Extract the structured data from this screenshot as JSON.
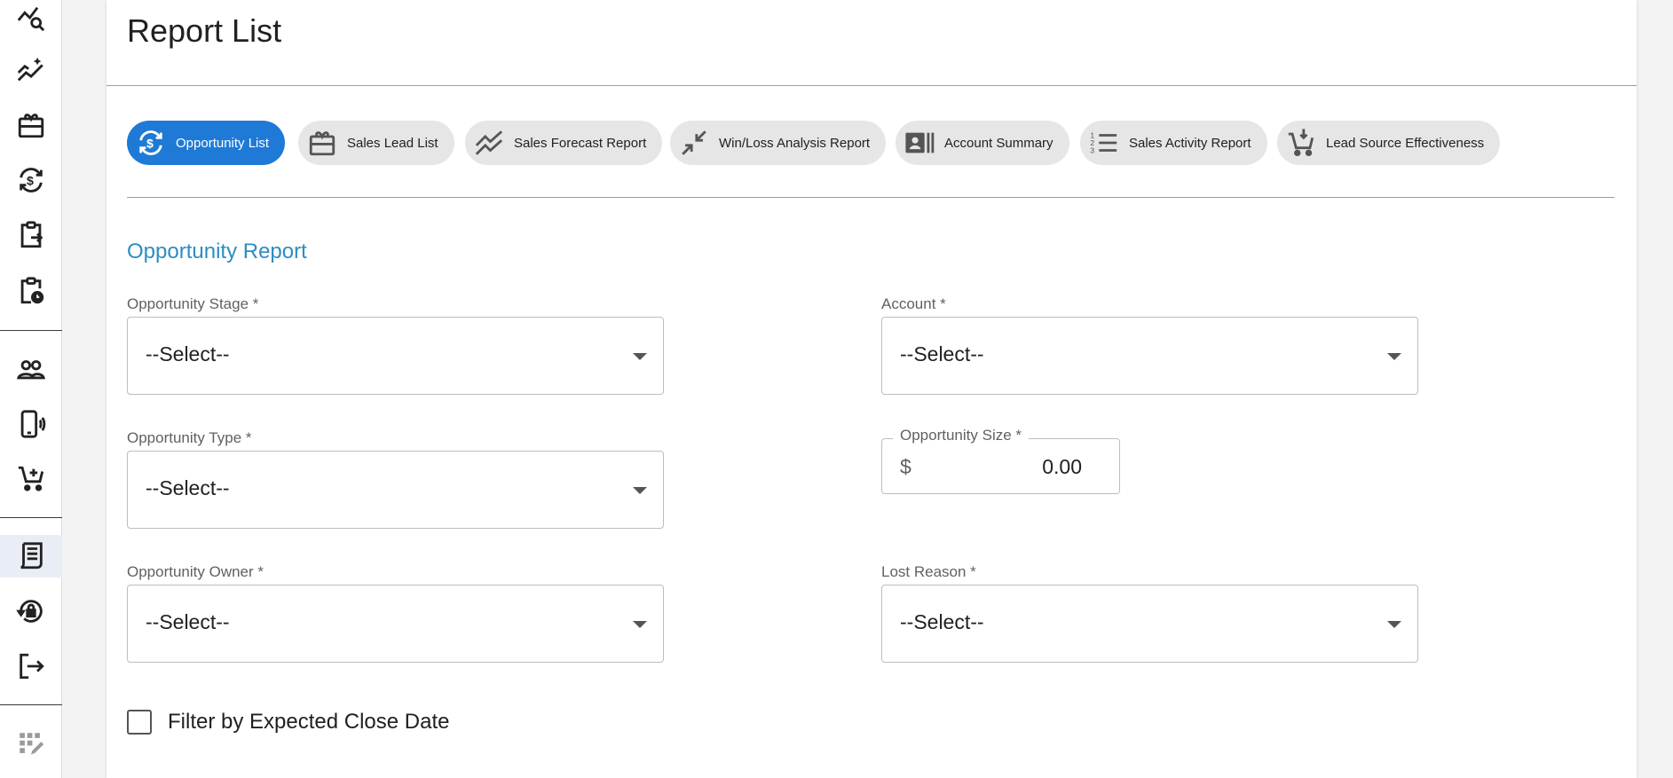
{
  "sidebar": {
    "items": [
      {
        "icon": "analytics-search-icon"
      },
      {
        "icon": "trend-sparkle-icon"
      },
      {
        "icon": "gift-card-icon"
      },
      {
        "icon": "currency-exchange-icon"
      },
      {
        "icon": "clipboard-move-icon"
      },
      {
        "icon": "clipboard-clock-icon"
      },
      {
        "icon": "people-icon"
      },
      {
        "icon": "phone-vibrate-icon"
      },
      {
        "icon": "add-cart-icon"
      },
      {
        "icon": "receipt-report-icon"
      },
      {
        "icon": "lock-reset-icon"
      },
      {
        "icon": "logout-icon"
      },
      {
        "icon": "grid-edit-icon"
      }
    ],
    "active_index": 9
  },
  "page": {
    "title": "Report List"
  },
  "tabs": [
    {
      "label": "Opportunity List",
      "icon": "currency-exchange-icon",
      "active": true
    },
    {
      "label": "Sales Lead List",
      "icon": "gift-card-icon",
      "active": false
    },
    {
      "label": "Sales Forecast Report",
      "icon": "trend-lines-icon",
      "active": false
    },
    {
      "label": "Win/Loss Analysis Report",
      "icon": "compress-arrows-icon",
      "active": false
    },
    {
      "label": "Account Summary",
      "icon": "contact-card-icon",
      "active": false
    },
    {
      "label": "Sales Activity Report",
      "icon": "numbered-list-icon",
      "active": false
    },
    {
      "label": "Lead Source Effectiveness",
      "icon": "cart-download-icon",
      "active": false
    }
  ],
  "section": {
    "title": "Opportunity Report"
  },
  "form": {
    "opportunity_stage": {
      "label": "Opportunity Stage *",
      "value": "--Select--"
    },
    "account": {
      "label": "Account *",
      "value": "--Select--"
    },
    "opportunity_type": {
      "label": "Opportunity Type *",
      "value": "--Select--"
    },
    "opportunity_size": {
      "label": "Opportunity Size *",
      "currency": "$",
      "value": "0.00"
    },
    "opportunity_owner": {
      "label": "Opportunity Owner *",
      "value": "--Select--"
    },
    "lost_reason": {
      "label": "Lost Reason *",
      "value": "--Select--"
    },
    "filter_close_date": {
      "label": "Filter by Expected Close Date",
      "checked": false
    }
  },
  "colors": {
    "accent": "#1e7ad6",
    "section_title": "#2d8dc2",
    "chip_bg": "#e6e6e6"
  }
}
